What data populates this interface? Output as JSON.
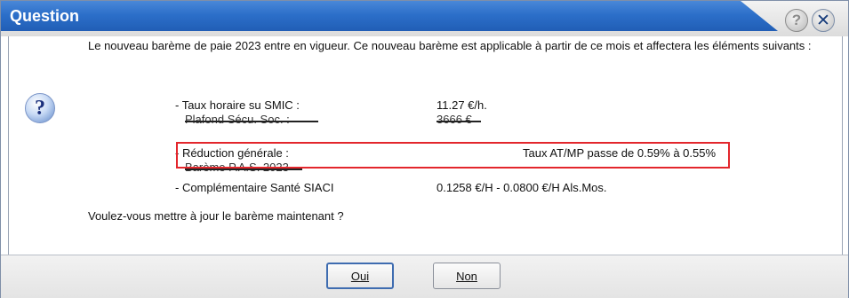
{
  "window": {
    "title": "Question"
  },
  "titlebar": {
    "help_glyph": "?",
    "close_glyph": "✕"
  },
  "icon": {
    "name": "question-icon",
    "glyph": "?"
  },
  "message": {
    "intro": "Le nouveau barème de paie 2023 entre en vigueur. Ce nouveau barème est applicable à partir de ce mois et affectera les éléments suivants :",
    "items": [
      {
        "label": "- Taux horaire su SMIC :",
        "value": "11.27 €/h."
      },
      {
        "label": "Plafond Sécu. Soc. :",
        "value": "3666 €"
      },
      {
        "label": "- Réduction générale :",
        "value": "Taux AT/MP passe de 0.59% à 0.55%"
      },
      {
        "label": "Barème P.A.S. 2023",
        "value": ""
      },
      {
        "label": "- Complémentaire Santé SIACI",
        "value": "0.1258 €/H - 0.0800 €/H Als.Mos."
      }
    ],
    "question": "Voulez-vous mettre à jour le barème maintenant ?"
  },
  "buttons": {
    "yes": "Oui",
    "no": "Non"
  },
  "colors": {
    "title_bar": "#2c6fc9",
    "highlight_border": "#e3262c",
    "default_button_border": "#3e6cb0"
  }
}
